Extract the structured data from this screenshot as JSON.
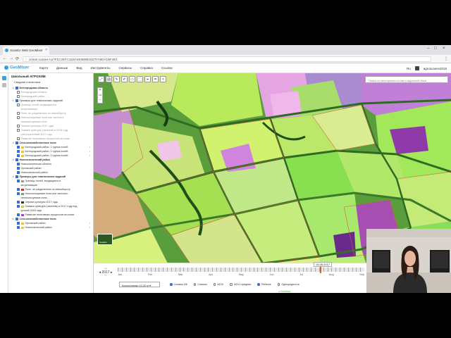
{
  "browser": {
    "tab_title": "ScanEx Web GeoMixer",
    "url": "ocean.scanex.ru/?F1C3EFC1D6A4E8B8B15D7FA8DA1BF4E1",
    "controls": [
      "←",
      "→",
      "⟳"
    ],
    "menu_icon": "⋮"
  },
  "app": {
    "logo": "GeoMixer",
    "menu": [
      "Карта",
      "Данные",
      "Вид",
      "Инструменты",
      "Сервисы",
      "Справка",
      "Ссылки"
    ],
    "lang": "Ru",
    "user": "agroscanex2018"
  },
  "panel": {
    "title": "Школьный АГРОХИМ",
    "subtitle": "Сводная статистика",
    "tree": [
      {
        "label": "Белгородская область",
        "level": 0,
        "checked": true,
        "bold": true,
        "toggle": "▾"
      },
      {
        "label": "Белгородская область",
        "level": 1,
        "checked": false,
        "dim": true
      },
      {
        "label": "Белгородский район",
        "level": 1,
        "checked": false,
        "dim": true
      },
      {
        "label": "Примеры для тематических заданий",
        "level": 0,
        "checked": true,
        "bold": false,
        "toggle": "▾"
      },
      {
        "label": "Границы полей, входящиеся в",
        "level": 1,
        "checked": false,
        "dim": true
      },
      {
        "label": "актуализацию",
        "level": 1,
        "dim": true,
        "nobox": true
      },
      {
        "label": "Поле, не разделенное по севообороту",
        "level": 1,
        "checked": false,
        "dim": true
      },
      {
        "label": "Неиспользуемые поля или частично",
        "level": 1,
        "checked": false,
        "dim": true
      },
      {
        "label": "неиспользуемые поля",
        "level": 1,
        "dim": true,
        "nobox": true
      },
      {
        "label": "Черные культуры 2017 года",
        "level": 1,
        "checked": false,
        "dim": true
      },
      {
        "label": "Озимые культуры (засеяны) в 2016 году",
        "level": 1,
        "checked": false,
        "dim": true
      },
      {
        "label": "или утраченный 2017 года",
        "level": 1,
        "dim": true,
        "nobox": true
      },
      {
        "label": "Развитие негативных процессов на полях",
        "level": 1,
        "checked": false,
        "dim": true
      },
      {
        "label": "Сельскохозяйственные поля",
        "level": 0,
        "checked": true,
        "bold": true,
        "toggle": "▾"
      },
      {
        "label": "Белгородский район, 1 группа полей",
        "level": 1,
        "checked": true,
        "swatch": "#e8c24a",
        "end": "›"
      },
      {
        "label": "Белгородский район, 2 группа полей",
        "level": 1,
        "checked": true,
        "swatch": "#e8c24a",
        "end": "›"
      },
      {
        "label": "Белгородский район, 3 группа полей",
        "level": 1,
        "checked": true,
        "swatch": "#e8c24a",
        "end": "›"
      },
      {
        "label": "Новоосколенский район",
        "level": 0,
        "checked": true,
        "bold": true,
        "toggle": "▾"
      },
      {
        "label": "Новоосколенская область",
        "level": 1,
        "checked": true
      },
      {
        "label": "Орловский район",
        "level": 1,
        "checked": true
      },
      {
        "label": "Новооскольский район",
        "level": 1,
        "checked": true
      },
      {
        "label": "Примеры для тематических заданий",
        "level": 0,
        "checked": true,
        "bold": true,
        "toggle": "▾"
      },
      {
        "label": "Границы полей, входящиеся в",
        "level": 1,
        "checked": true,
        "swatch": "#999"
      },
      {
        "label": "актуализацию",
        "level": 1,
        "nobox": true
      },
      {
        "label": "Поле, не разделенное по севообороту",
        "level": 1,
        "checked": true,
        "swatch": "#c33"
      },
      {
        "label": "Неиспользуемые поля или частично",
        "level": 1,
        "checked": true,
        "swatch": "#6a6"
      },
      {
        "label": "неиспользуемые поля",
        "level": 1,
        "nobox": true
      },
      {
        "label": "Черные культуры 2017 года",
        "level": 1,
        "checked": true,
        "swatch": "#333"
      },
      {
        "label": "Озимые культуры (засеяны) в 2017 году под",
        "level": 1,
        "checked": true,
        "swatch": "#cc4"
      },
      {
        "label": "урожай 2018 года",
        "level": 1,
        "nobox": true
      },
      {
        "label": "Развитие негативных процессов на полях",
        "level": 1,
        "checked": true,
        "swatch": "#a4c"
      },
      {
        "label": "Сельскохозяйственные поля",
        "level": 0,
        "checked": true,
        "bold": true,
        "toggle": "▾"
      },
      {
        "label": "Орловский район",
        "level": 1,
        "checked": true,
        "swatch": "#e8c24a",
        "end": "›"
      },
      {
        "label": "Новооскольский район",
        "level": 1,
        "checked": true,
        "swatch": "#e8c24a",
        "end": "›"
      }
    ]
  },
  "map": {
    "search_placeholder": "Поиск по векторным слоям и адресной базе",
    "zoom_in": "+",
    "zoom_level": "14",
    "zoom_out": "−",
    "minimap_label": "Снимки",
    "tools": [
      "⤢",
      "🖨",
      "✎",
      "✐",
      "▭",
      "⬚",
      "⌖",
      "⌗",
      "<"
    ]
  },
  "timeline": {
    "year": "2017",
    "date": "15.08.2017",
    "months": [
      "Jan",
      "Feb",
      "Mar",
      "Apr",
      "May",
      "Jun",
      "Jul",
      "Aug",
      "Sep"
    ],
    "layer_select": "Космоснимки 10-30 м",
    "options": [
      {
        "label": "Снимок ИК",
        "on": true
      },
      {
        "label": "Снимок",
        "on": false
      },
      {
        "label": "NDVI",
        "on": false
      },
      {
        "label": "NDVI средние",
        "on": false
      },
      {
        "label": "Рейтинг",
        "on": true
      },
      {
        "label": "Однородность",
        "on": false
      }
    ],
    "provider": "GeoMixer",
    "progress_fraction": 0.82
  }
}
